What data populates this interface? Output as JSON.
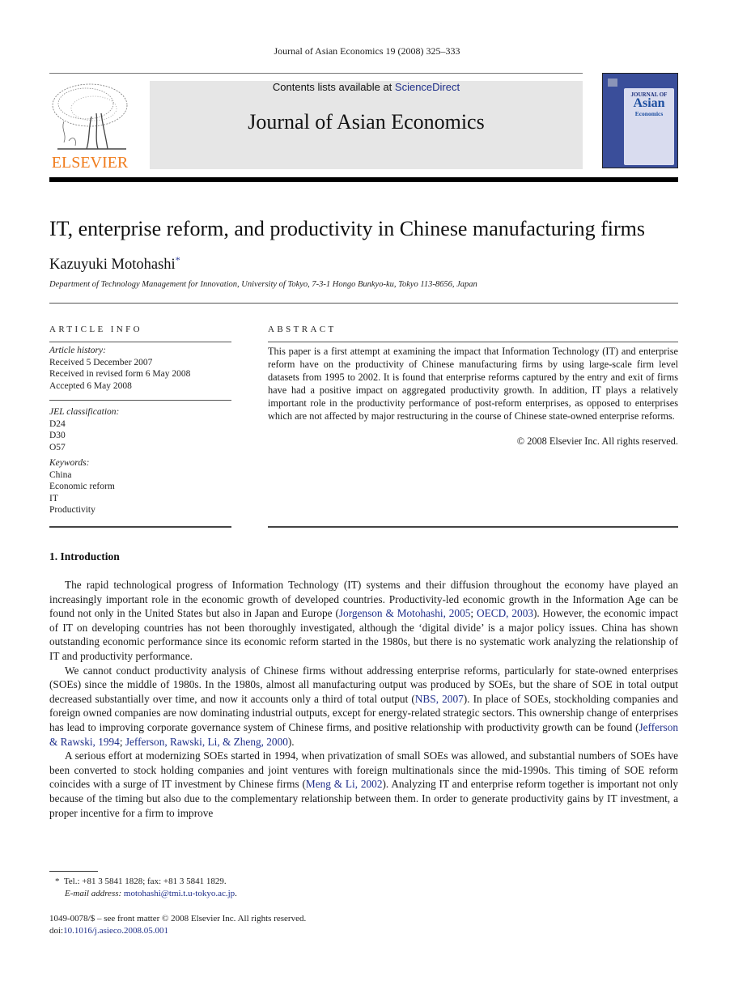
{
  "journal": {
    "running_head": "Journal of Asian Economics 19 (2008) 325–333",
    "contents_prefix": "Contents lists available at ",
    "contents_link": "ScienceDirect",
    "title": "Journal of Asian Economics",
    "publisher_logo": "ELSEVIER",
    "cover": {
      "line1": "JOURNAL OF",
      "line2": "Asian",
      "line3": "Economics"
    }
  },
  "article": {
    "title": "IT, enterprise reform, and productivity in Chinese manufacturing firms",
    "author": "Kazuyuki Motohashi",
    "author_mark": "*",
    "affiliation": "Department of Technology Management for Innovation, University of Tokyo, 7-3-1 Hongo Bunkyo-ku, Tokyo 113-8656, Japan"
  },
  "article_info": {
    "heading": "ARTICLE INFO",
    "history_label": "Article history:",
    "history": [
      "Received 5 December 2007",
      "Received in revised form 6 May 2008",
      "Accepted 6 May 2008"
    ],
    "jel_label": "JEL classification:",
    "jel": [
      "D24",
      "D30",
      "O57"
    ],
    "keywords_label": "Keywords:",
    "keywords": [
      "China",
      "Economic reform",
      "IT",
      "Productivity"
    ]
  },
  "abstract": {
    "heading": "ABSTRACT",
    "text": "This paper is a first attempt at examining the impact that Information Technology (IT) and enterprise reform have on the productivity of Chinese manufacturing firms by using large-scale firm level datasets from 1995 to 2002. It is found that enterprise reforms captured by the entry and exit of firms have had a positive impact on aggregated productivity growth. In addition, IT plays a relatively important role in the productivity performance of post-reform enterprises, as opposed to enterprises which are not affected by major restructuring in the course of Chinese state-owned enterprise reforms.",
    "copyright": "© 2008 Elsevier Inc. All rights reserved."
  },
  "section": {
    "heading": "1.  Introduction",
    "p1": {
      "a": "The rapid technological progress of Information Technology (IT) systems and their diffusion throughout the economy have played an increasingly important role in the economic growth of developed countries. Productivity-led economic growth in the Information Age can be found not only in the United States but also in Japan and Europe (",
      "ref1": "Jorgenson & Motohashi, 2005",
      "sep": "; ",
      "ref2": "OECD, 2003",
      "b": "). However, the economic impact of IT on developing countries has not been thoroughly investigated, although the ‘digital divide’ is a major policy issues. China has shown outstanding economic performance since its economic reform started in the 1980s, but there is no systematic work analyzing the relationship of IT and productivity performance."
    },
    "p2": {
      "a": "We cannot conduct productivity analysis of Chinese firms without addressing enterprise reforms, particularly for state-owned enterprises (SOEs) since the middle of 1980s. In the 1980s, almost all manufacturing output was produced by SOEs, but the share of SOE in total output decreased substantially over time, and now it accounts only a third of total output (",
      "ref1": "NBS, 2007",
      "b": "). In place of SOEs, stockholding companies and foreign owned companies are now dominating industrial outputs, except for energy-related strategic sectors. This ownership change of enterprises has lead to improving corporate governance system of Chinese firms, and positive relationship with productivity growth can be found (",
      "ref2": "Jefferson & Rawski, 1994",
      "sep": "; ",
      "ref3": "Jefferson, Rawski, Li, & Zheng, 2000",
      "c": ")."
    },
    "p3": {
      "a": "A serious effort at modernizing SOEs started in 1994, when privatization of small SOEs was allowed, and substantial numbers of SOEs have been converted to stock holding companies and joint ventures with foreign multinationals since the mid-1990s. This timing of SOE reform coincides with a surge of IT investment by Chinese firms (",
      "ref1": "Meng & Li, 2002",
      "b": "). Analyzing IT and enterprise reform together is important not only because of the timing but also due to the complementary relationship between them. In order to generate productivity gains by IT investment, a proper incentive for a firm to improve"
    }
  },
  "footnote": {
    "mark": "*",
    "contact": "Tel.: +81 3 5841 1828; fax: +81 3 5841 1829.",
    "email_label": "E-mail address: ",
    "email": "motohashi@tmi.t.u-tokyo.ac.jp",
    "email_end": "."
  },
  "front_matter": {
    "issn_line": "1049-0078/$ – see front matter © 2008 Elsevier Inc. All rights reserved.",
    "doi_prefix": "doi:",
    "doi": "10.1016/j.asieco.2008.05.001"
  }
}
